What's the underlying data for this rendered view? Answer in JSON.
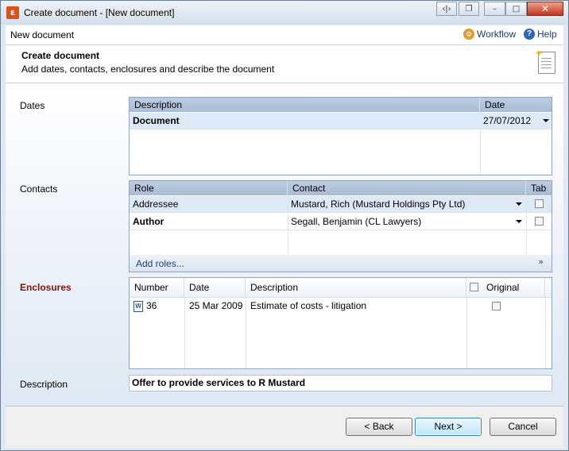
{
  "window": {
    "title": "Create document - [New document]",
    "tb_icons": [
      "‹|›",
      "❐",
      "–",
      "□",
      "✕"
    ]
  },
  "header": {
    "title": "New document",
    "workflow_label": "Workflow",
    "help_label": "Help"
  },
  "banner": {
    "title": "Create document",
    "subtitle": "Add dates, contacts, enclosures and describe the document"
  },
  "dates": {
    "label": "Dates",
    "columns": [
      "Description",
      "Date"
    ],
    "rows": [
      {
        "description": "Document",
        "date": "27/07/2012"
      }
    ]
  },
  "contacts": {
    "label": "Contacts",
    "columns": [
      "Role",
      "Contact",
      "Tab"
    ],
    "rows": [
      {
        "role": "Addressee",
        "contact": "Mustard, Rich (Mustard Holdings Pty Ltd)"
      },
      {
        "role": "Author",
        "contact": "Segall, Benjamin (CL Lawyers)"
      }
    ],
    "add_roles_label": "Add roles..."
  },
  "enclosures": {
    "label": "Enclosures",
    "label_color": "#7a1414",
    "columns": [
      "Number",
      "Date",
      "Description",
      "Original"
    ],
    "rows": [
      {
        "number": "36",
        "date": "25 Mar 2009",
        "description": "Estimate of costs - litigation"
      }
    ]
  },
  "description": {
    "label": "Description",
    "value": "Offer to provide services to R Mustard"
  },
  "footer": {
    "back_label": "< Back",
    "next_label": "Next >",
    "cancel_label": "Cancel"
  }
}
